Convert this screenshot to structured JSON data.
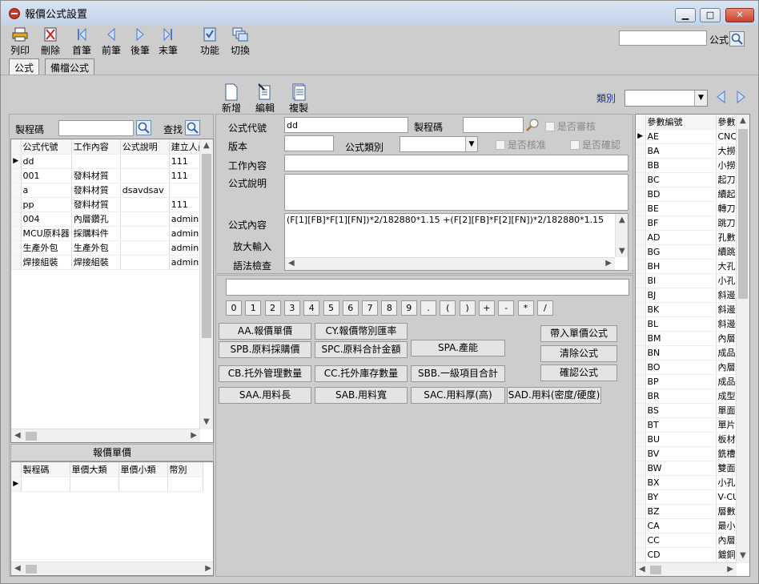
{
  "window": {
    "title": "報價公式設置",
    "min": "▁",
    "max": "□",
    "close": "✕"
  },
  "toolbar": {
    "print": "列印",
    "delete": "刪除",
    "first": "首筆",
    "prev": "前筆",
    "next": "後筆",
    "last": "末筆",
    "function": "功能",
    "switch": "切換",
    "search_label": "公式",
    "search_value": ""
  },
  "tabs": [
    "公式",
    "備檔公式"
  ],
  "subtoolbar": {
    "add": "新增",
    "edit": "編輯",
    "copy": "複製",
    "category_label": "類別",
    "category_value": ""
  },
  "left": {
    "process_label": "製程碼",
    "process_value": "",
    "find_label": "查找",
    "columns": [
      "公式代號",
      "工作內容",
      "公式說明",
      "建立人員"
    ],
    "rows": [
      [
        "dd",
        "",
        "",
        "111"
      ],
      [
        "001",
        "發料材質",
        "",
        "111"
      ],
      [
        "a",
        "發料材質",
        "dsavdsav",
        ""
      ],
      [
        "pp",
        "發料材質",
        "",
        "111"
      ],
      [
        "004",
        "內層鑽孔",
        "",
        "admin"
      ],
      [
        "MCU原料器",
        "採購料件",
        "",
        "admin"
      ],
      [
        "生產外包",
        "生產外包",
        "",
        "admin"
      ],
      [
        "焊接組裝",
        "焊接組裝",
        "",
        "admin"
      ]
    ],
    "price_title": "報價單價",
    "price_columns": [
      "製程碼",
      "單價大類",
      "單價小類",
      "幣別"
    ]
  },
  "form": {
    "code_label": "公式代號",
    "code_value": "dd",
    "process_label": "製程碼",
    "process_value": "",
    "review_label": "是否審核",
    "version_label": "版本",
    "version_value": "",
    "category_label": "公式類別",
    "category_value": "",
    "approve_label": "是否核准",
    "confirm_label": "是否確認",
    "work_label": "工作內容",
    "work_value": "",
    "desc_label": "公式說明",
    "desc_value": "",
    "content_label": "公式內容",
    "content_value": "(F[1][FB]*F[1][FN])*2/182880*1.15 +(F[2][FB]*F[2][FN])*2/182880*1.15",
    "zoom_label": "放大輸入",
    "syntax_label": "語法檢查"
  },
  "keypad": [
    "0",
    "1",
    "2",
    "3",
    "4",
    "5",
    "6",
    "7",
    "8",
    "9",
    ".",
    "(",
    ")",
    "+",
    "-",
    "*",
    "/"
  ],
  "formula_buttons": {
    "aa": "AA.報價單價",
    "cy": "CY.報價幣別匯率",
    "spb": "SPB.原料採購價",
    "spc": "SPC.原料合計金額",
    "spa": "SPA.產能",
    "cb": "CB.托外管理數量",
    "cc": "CC.托外庫存數量",
    "sbb": "SBB.一級項目合計",
    "saa": "SAA.用料長",
    "sab": "SAB.用料寬",
    "sac": "SAC.用料厚(高)",
    "sad": "SAD.用料(密度/硬度)",
    "bring": "帶入單價公式",
    "clear": "清除公式",
    "confirm": "確認公式"
  },
  "params": {
    "columns": [
      "參數編號",
      "參數"
    ],
    "rows": [
      [
        "AE",
        "CNC"
      ],
      [
        "BA",
        "大撈"
      ],
      [
        "BB",
        "小撈"
      ],
      [
        "BC",
        "起刀"
      ],
      [
        "BD",
        "續起"
      ],
      [
        "BE",
        "轉刀"
      ],
      [
        "BF",
        "跳刀"
      ],
      [
        "AD",
        "孔數"
      ],
      [
        "BG",
        "續跳"
      ],
      [
        "BH",
        "大孔"
      ],
      [
        "BI",
        "小孔"
      ],
      [
        "BJ",
        "斜邊"
      ],
      [
        "BK",
        "斜邊"
      ],
      [
        "BL",
        "斜邊"
      ],
      [
        "BM",
        "內層"
      ],
      [
        "BN",
        "成品"
      ],
      [
        "BO",
        "內層"
      ],
      [
        "BP",
        "成品"
      ],
      [
        "BR",
        "成型"
      ],
      [
        "BS",
        "單面"
      ],
      [
        "BT",
        "單片"
      ],
      [
        "BU",
        "板材"
      ],
      [
        "BV",
        "銑槽"
      ],
      [
        "BW",
        "雙面"
      ],
      [
        "BX",
        "小孔"
      ],
      [
        "BY",
        "V-CU"
      ],
      [
        "BZ",
        "層數"
      ],
      [
        "CA",
        "最小"
      ],
      [
        "CC",
        "內層"
      ],
      [
        "CD",
        "鍍銅"
      ]
    ]
  },
  "colors": {
    "accent": "#1a2ea0",
    "bg": "#cdcdcd"
  }
}
